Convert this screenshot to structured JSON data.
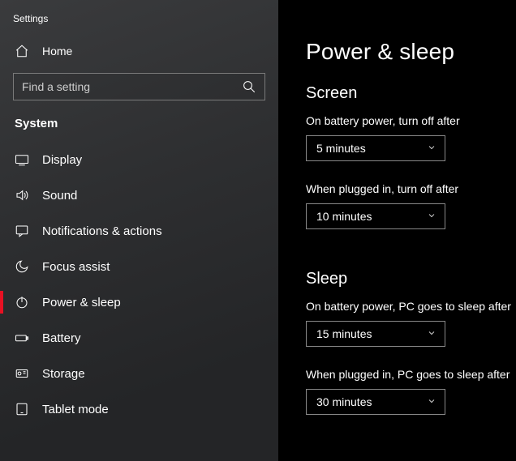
{
  "window_title": "Settings",
  "home_label": "Home",
  "search_placeholder": "Find a setting",
  "category": "System",
  "nav": [
    {
      "label": "Display"
    },
    {
      "label": "Sound"
    },
    {
      "label": "Notifications & actions"
    },
    {
      "label": "Focus assist"
    },
    {
      "label": "Power & sleep"
    },
    {
      "label": "Battery"
    },
    {
      "label": "Storage"
    },
    {
      "label": "Tablet mode"
    }
  ],
  "page": {
    "title": "Power & sleep",
    "sections": [
      {
        "title": "Screen",
        "fields": [
          {
            "label": "On battery power, turn off after",
            "value": "5 minutes"
          },
          {
            "label": "When plugged in, turn off after",
            "value": "10 minutes"
          }
        ]
      },
      {
        "title": "Sleep",
        "fields": [
          {
            "label": "On battery power, PC goes to sleep after",
            "value": "15 minutes"
          },
          {
            "label": "When plugged in, PC goes to sleep after",
            "value": "30 minutes"
          }
        ]
      }
    ]
  }
}
